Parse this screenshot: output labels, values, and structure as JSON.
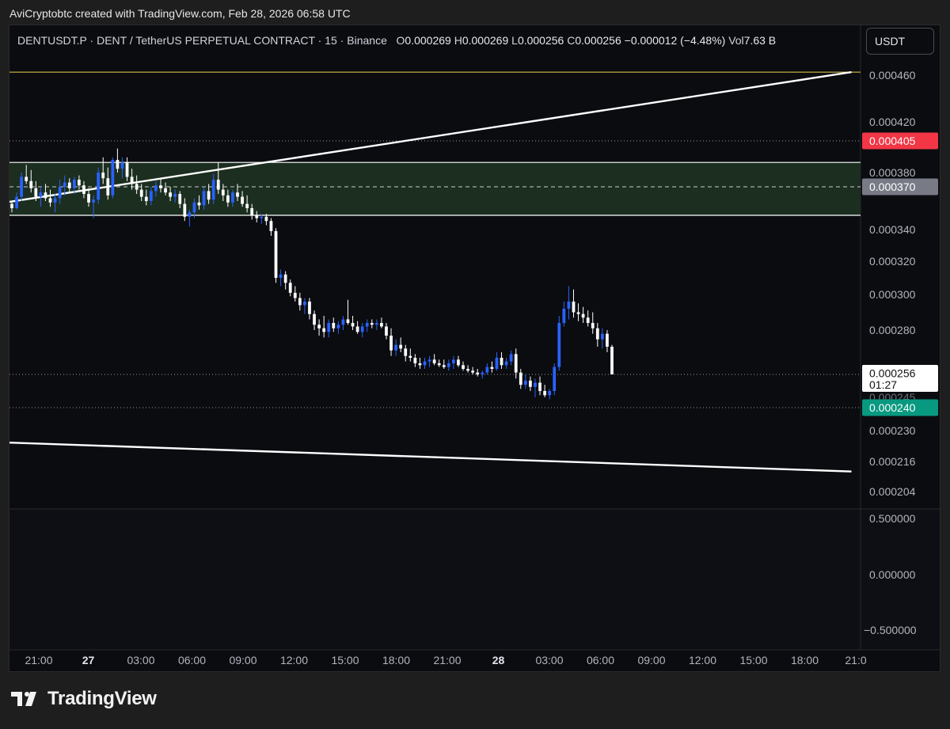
{
  "caption": "AviCryptobtc created with TradingView.com, Feb 28, 2026 06:58 UTC",
  "header": {
    "symbol": "DENTUSDT.P",
    "description": "DENT / TetherUS PERPETUAL CONTRACT",
    "interval": "15",
    "exchange": "Binance",
    "open_label": "O",
    "open": "0.000269",
    "high_label": "H",
    "high": "0.000269",
    "low_label": "L",
    "low": "0.000256",
    "close_label": "C",
    "close": "0.000256",
    "change": "−0.000012 (−4.48%)",
    "vol_label": "Vol",
    "vol": "7.63 B",
    "currency": "USDT"
  },
  "brand": {
    "name": "TradingView",
    "logo_icon": "tradingview-logo-icon"
  },
  "colors": {
    "background": "#0b0c10",
    "candle_up": "#2962ff",
    "candle_down": "#ffffff",
    "zone_fill": "#1b2e1f",
    "yellow_line": "#e8d44d",
    "red_badge": "#f23645",
    "gray_badge": "#787b86",
    "green_badge": "#089981"
  },
  "chart_data": {
    "type": "candlestick",
    "price_axis_labels": [
      "0.000460",
      "0.000420",
      "0.000380",
      "0.000340",
      "0.000320",
      "0.000300",
      "0.000280",
      "0.000230",
      "0.000216",
      "0.000204"
    ],
    "time_axis_labels": [
      "21:00",
      "27",
      "03:00",
      "06:00",
      "09:00",
      "12:00",
      "15:00",
      "18:00",
      "21:00",
      "28",
      "03:00",
      "06:00",
      "09:00",
      "12:00",
      "15:00",
      "18:00",
      "21:0"
    ],
    "bold_time_labels": [
      "27",
      "28"
    ],
    "indicator_axis_labels": [
      "0.500000",
      "0.000000",
      "−0.500000"
    ],
    "badges": [
      {
        "value": "0.000405",
        "color": "#f23645"
      },
      {
        "value": "0.000370",
        "color": "#787b86"
      },
      {
        "value": "0.000256",
        "sub": "01:27",
        "color": "#ffffff"
      },
      {
        "value": "0.000240",
        "color": "#089981"
      }
    ],
    "hidden_label": "0.000245",
    "horizontal_lines": [
      {
        "price": 0.000463,
        "style": "solid",
        "color": "#e8d44d"
      },
      {
        "price": 0.000405,
        "style": "dotted"
      },
      {
        "price": 0.00037,
        "style": "dashed"
      },
      {
        "price": 0.000256,
        "style": "dotted"
      },
      {
        "price": 0.00024,
        "style": "dotted"
      }
    ],
    "zone": {
      "top": 0.000388,
      "bottom": 0.00035
    },
    "trendlines": [
      {
        "x_start": "25 19:00",
        "y_start": 0.000317,
        "x_end": "28 21:00",
        "y_end": 0.000463
      },
      {
        "x_start": "25 19:00",
        "y_start": 0.000231,
        "x_end": "28 21:00",
        "y_end": 0.000212
      }
    ],
    "candles": [
      [
        0.000358,
        0.00036,
        0.000352,
        0.000355
      ],
      [
        0.000355,
        0.000366,
        0.000354,
        0.000363
      ],
      [
        0.000363,
        0.00038,
        0.00036,
        0.000377
      ],
      [
        0.000377,
        0.000386,
        0.000372,
        0.000374
      ],
      [
        0.000374,
        0.000382,
        0.000366,
        0.000369
      ],
      [
        0.000369,
        0.000374,
        0.00036,
        0.000363
      ],
      [
        0.000363,
        0.00037,
        0.000356,
        0.000366
      ],
      [
        0.000366,
        0.000372,
        0.00036,
        0.000362
      ],
      [
        0.000362,
        0.000368,
        0.000356,
        0.000359
      ],
      [
        0.000359,
        0.000365,
        0.000352,
        0.000362
      ],
      [
        0.000362,
        0.000375,
        0.000358,
        0.00037
      ],
      [
        0.00037,
        0.000378,
        0.000364,
        0.000373
      ],
      [
        0.000373,
        0.000376,
        0.000366,
        0.000369
      ],
      [
        0.000369,
        0.000377,
        0.000365,
        0.000375
      ],
      [
        0.000375,
        0.000378,
        0.000368,
        0.000371
      ],
      [
        0.000371,
        0.000374,
        0.000362,
        0.000365
      ],
      [
        0.000365,
        0.000369,
        0.000356,
        0.000359
      ],
      [
        0.000359,
        0.000364,
        0.000348,
        0.000361
      ],
      [
        0.000361,
        0.000384,
        0.000358,
        0.00038
      ],
      [
        0.00038,
        0.000392,
        0.000372,
        0.000376
      ],
      [
        0.000376,
        0.000384,
        0.000361,
        0.000364
      ],
      [
        0.000364,
        0.000392,
        0.000362,
        0.00039
      ],
      [
        0.00039,
        0.000399,
        0.00038,
        0.000383
      ],
      [
        0.000383,
        0.000392,
        0.000376,
        0.000388
      ],
      [
        0.000388,
        0.000392,
        0.000374,
        0.000377
      ],
      [
        0.000377,
        0.000383,
        0.000368,
        0.000372
      ],
      [
        0.000372,
        0.000378,
        0.000365,
        0.000368
      ],
      [
        0.000368,
        0.000372,
        0.00036,
        0.000363
      ],
      [
        0.000363,
        0.000368,
        0.000357,
        0.00036
      ],
      [
        0.00036,
        0.00037,
        0.000357,
        0.000367
      ],
      [
        0.000367,
        0.000374,
        0.000363,
        0.000371
      ],
      [
        0.000371,
        0.000376,
        0.000366,
        0.000369
      ],
      [
        0.000369,
        0.000373,
        0.000364,
        0.000366
      ],
      [
        0.000366,
        0.00037,
        0.00036,
        0.000363
      ],
      [
        0.000363,
        0.000368,
        0.000359,
        0.000365
      ],
      [
        0.000365,
        0.000367,
        0.000355,
        0.000358
      ],
      [
        0.000358,
        0.000362,
        0.000346,
        0.000349
      ],
      [
        0.000349,
        0.000354,
        0.000342,
        0.000352
      ],
      [
        0.000352,
        0.000362,
        0.000348,
        0.000359
      ],
      [
        0.000359,
        0.000364,
        0.000354,
        0.000357
      ],
      [
        0.000357,
        0.00037,
        0.000354,
        0.000367
      ],
      [
        0.000367,
        0.000372,
        0.000358,
        0.000361
      ],
      [
        0.000361,
        0.000379,
        0.000358,
        0.000375
      ],
      [
        0.000375,
        0.000388,
        0.000365,
        0.000368
      ],
      [
        0.000368,
        0.000372,
        0.00036,
        0.000364
      ],
      [
        0.000364,
        0.000368,
        0.000356,
        0.000359
      ],
      [
        0.000359,
        0.000368,
        0.000356,
        0.000366
      ],
      [
        0.000366,
        0.000372,
        0.00036,
        0.000363
      ],
      [
        0.000363,
        0.000367,
        0.000356,
        0.000358
      ],
      [
        0.000358,
        0.000364,
        0.000352,
        0.000355
      ],
      [
        0.000355,
        0.000358,
        0.000347,
        0.00035
      ],
      [
        0.00035,
        0.000353,
        0.000345,
        0.000348
      ],
      [
        0.000348,
        0.000351,
        0.000344,
        0.000349
      ],
      [
        0.000349,
        0.000351,
        0.000343,
        0.000346
      ],
      [
        0.000346,
        0.000348,
        0.000336,
        0.000339
      ],
      [
        0.000339,
        0.000341,
        0.000307,
        0.00031
      ],
      [
        0.00031,
        0.000315,
        0.000305,
        0.000312
      ],
      [
        0.000312,
        0.000314,
        0.000303,
        0.000307
      ],
      [
        0.000307,
        0.000309,
        0.000299,
        0.000301
      ],
      [
        0.000301,
        0.000305,
        0.000296,
        0.000298
      ],
      [
        0.000298,
        0.000301,
        0.000291,
        0.000294
      ],
      [
        0.000294,
        0.000298,
        0.000289,
        0.000296
      ],
      [
        0.000296,
        0.000298,
        0.000286,
        0.000289
      ],
      [
        0.000289,
        0.000291,
        0.00028,
        0.000283
      ],
      [
        0.000283,
        0.000286,
        0.000277,
        0.000281
      ],
      [
        0.000281,
        0.000288,
        0.000276,
        0.000279
      ],
      [
        0.000279,
        0.000286,
        0.000276,
        0.000284
      ],
      [
        0.000284,
        0.000287,
        0.000279,
        0.000281
      ],
      [
        0.000281,
        0.000285,
        0.000278,
        0.000283
      ],
      [
        0.000283,
        0.000288,
        0.00028,
        0.000286
      ],
      [
        0.000286,
        0.000297,
        0.000283,
        0.000284
      ],
      [
        0.000284,
        0.000288,
        0.00028,
        0.000282
      ],
      [
        0.000282,
        0.000285,
        0.000278,
        0.000279
      ],
      [
        0.000279,
        0.000284,
        0.000276,
        0.000282
      ],
      [
        0.000282,
        0.000286,
        0.000279,
        0.000284
      ],
      [
        0.000284,
        0.000286,
        0.000281,
        0.000283
      ],
      [
        0.000283,
        0.000286,
        0.00028,
        0.000284
      ],
      [
        0.000284,
        0.000287,
        0.000281,
        0.000282
      ],
      [
        0.000282,
        0.000284,
        0.000275,
        0.000277
      ],
      [
        0.000277,
        0.000281,
        0.000266,
        0.000269
      ],
      [
        0.000269,
        0.000275,
        0.000266,
        0.000272
      ],
      [
        0.000272,
        0.000276,
        0.000268,
        0.00027
      ],
      [
        0.00027,
        0.000272,
        0.000263,
        0.000266
      ],
      [
        0.000266,
        0.00027,
        0.000263,
        0.000265
      ],
      [
        0.000265,
        0.000267,
        0.00026,
        0.000262
      ],
      [
        0.000262,
        0.000265,
        0.000259,
        0.000261
      ],
      [
        0.000261,
        0.000265,
        0.000259,
        0.000263
      ],
      [
        0.000263,
        0.000266,
        0.00026,
        0.000264
      ],
      [
        0.000264,
        0.000267,
        0.000261,
        0.000262
      ],
      [
        0.000262,
        0.000264,
        0.00026,
        0.000261
      ],
      [
        0.000261,
        0.000264,
        0.000259,
        0.00026
      ],
      [
        0.00026,
        0.000264,
        0.000258,
        0.000262
      ],
      [
        0.000262,
        0.000266,
        0.000259,
        0.000264
      ],
      [
        0.000264,
        0.000266,
        0.00026,
        0.000261
      ],
      [
        0.000261,
        0.000263,
        0.000258,
        0.000259
      ],
      [
        0.000259,
        0.000261,
        0.000257,
        0.000258
      ],
      [
        0.000258,
        0.00026,
        0.000256,
        0.000257
      ],
      [
        0.000257,
        0.000259,
        0.000255,
        0.000256
      ],
      [
        0.000256,
        0.000258,
        0.000254,
        0.000257
      ],
      [
        0.000257,
        0.000262,
        0.000256,
        0.00026
      ],
      [
        0.00026,
        0.000263,
        0.000257,
        0.000259
      ],
      [
        0.000259,
        0.000268,
        0.000258,
        0.000265
      ],
      [
        0.000265,
        0.000268,
        0.000259,
        0.000261
      ],
      [
        0.000261,
        0.000265,
        0.000259,
        0.000263
      ],
      [
        0.000263,
        0.000269,
        0.000261,
        0.000267
      ],
      [
        0.000267,
        0.00027,
        0.000254,
        0.000257
      ],
      [
        0.000257,
        0.000259,
        0.000249,
        0.000251
      ],
      [
        0.000251,
        0.000256,
        0.000249,
        0.000253
      ],
      [
        0.000253,
        0.000255,
        0.000248,
        0.00025
      ],
      [
        0.00025,
        0.000254,
        0.000245,
        0.000252
      ],
      [
        0.000252,
        0.000255,
        0.000246,
        0.000248
      ],
      [
        0.000248,
        0.000251,
        0.000245,
        0.000246
      ],
      [
        0.000246,
        0.000249,
        0.000244,
        0.000248
      ],
      [
        0.000248,
        0.000262,
        0.000246,
        0.00026
      ],
      [
        0.00026,
        0.000288,
        0.000258,
        0.000284
      ],
      [
        0.000284,
        0.000296,
        0.000282,
        0.000292
      ],
      [
        0.000292,
        0.000305,
        0.000286,
        0.000296
      ],
      [
        0.000296,
        0.000303,
        0.000287,
        0.00029
      ],
      [
        0.00029,
        0.000295,
        0.000285,
        0.000289
      ],
      [
        0.000289,
        0.000293,
        0.000284,
        0.000287
      ],
      [
        0.000287,
        0.000291,
        0.000282,
        0.000284
      ],
      [
        0.000284,
        0.00029,
        0.000278,
        0.000281
      ],
      [
        0.000281,
        0.000284,
        0.000271,
        0.000275
      ],
      [
        0.000275,
        0.000281,
        0.00027,
        0.000278
      ],
      [
        0.000278,
        0.00028,
        0.000268,
        0.000271
      ],
      [
        0.000271,
        0.000272,
        0.000256,
        0.000256
      ]
    ]
  }
}
